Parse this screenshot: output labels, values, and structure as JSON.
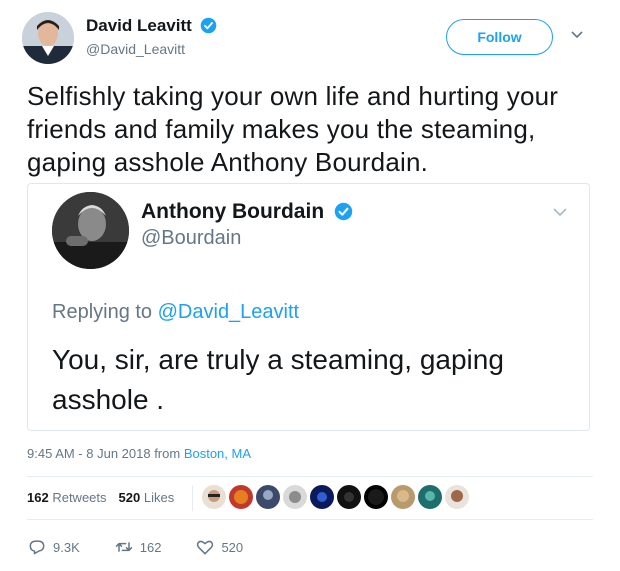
{
  "tweet": {
    "author_name": "David Leavitt",
    "author_handle": "@David_Leavitt",
    "follow_label": "Follow",
    "text": "Selfishly taking your own life and hurting your friends and family makes you the steaming, gaping asshole Anthony Bourdain.",
    "timestamp": "9:45 AM - 8 Jun 2018 from ",
    "location": "Boston, MA"
  },
  "quoted": {
    "author_name": "Anthony Bourdain",
    "author_handle": "@Bourdain",
    "replying_prefix": "Replying to ",
    "replying_handle": "@David_Leavitt",
    "text": "You, sir, are truly a steaming, gaping asshole ."
  },
  "stats": {
    "retweets_count": "162",
    "retweets_label": "Retweets",
    "likes_count": "520",
    "likes_label": "Likes"
  },
  "actions": {
    "reply_count": "9.3K",
    "retweet_count": "162",
    "like_count": "520"
  },
  "colors": {
    "accent": "#1da1f2",
    "muted": "#657786",
    "text": "#14171a"
  },
  "icons": [
    "verified-badge-icon",
    "chevron-down-icon",
    "reply-icon",
    "retweet-icon",
    "heart-icon"
  ]
}
